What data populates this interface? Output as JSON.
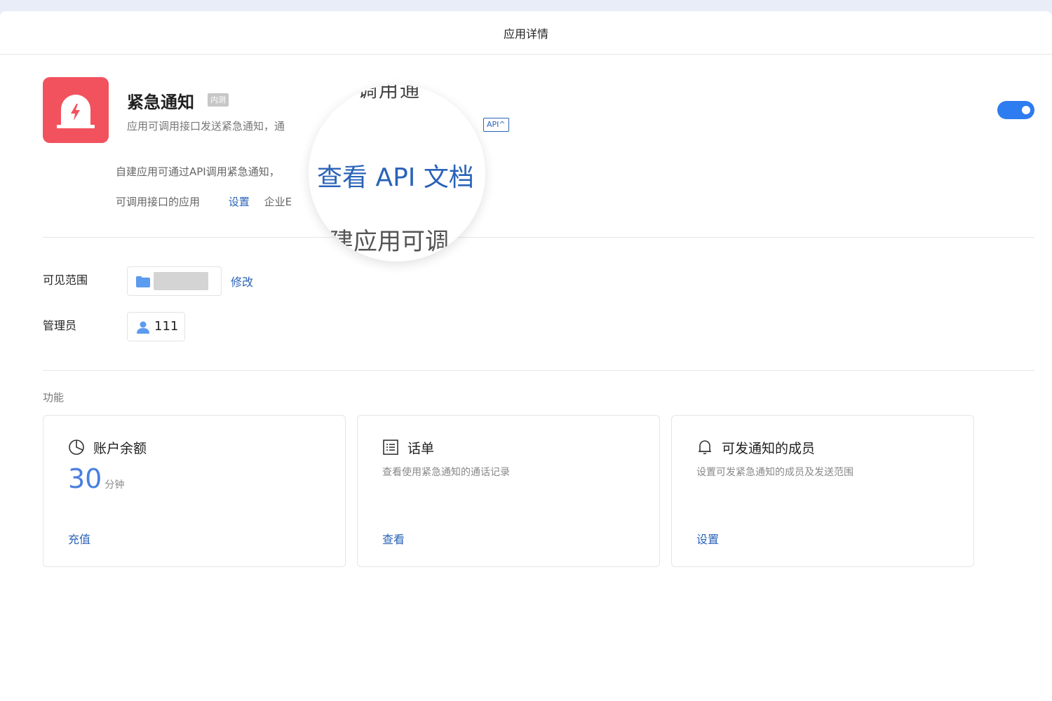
{
  "window": {
    "title": "应用详情"
  },
  "app": {
    "name": "紧急通知",
    "tag": "内测",
    "description": "应用可调用接口发送紧急通知，通",
    "api_badge": "API^",
    "enabled": true
  },
  "info": {
    "line1": "自建应用可通过API调用紧急通知，",
    "callable_label": "可调用接口的应用",
    "settings_link": "设置",
    "enterprise_text": "企业E"
  },
  "magnifier": {
    "top_text": "调用通",
    "link_text": "查看 API 文档",
    "bottom_text": "建应用可调"
  },
  "visibility": {
    "label": "可见范围",
    "modify_link": "修改"
  },
  "admin": {
    "label": "管理员",
    "value": "111"
  },
  "features": {
    "title": "功能",
    "cards": [
      {
        "icon": "pie-chart-icon",
        "title": "账户余额",
        "balance_value": "30",
        "balance_unit": "分钟",
        "action": "充值"
      },
      {
        "icon": "list-icon",
        "title": "话单",
        "description": "查看使用紧急通知的通话记录",
        "action": "查看"
      },
      {
        "icon": "bell-icon",
        "title": "可发通知的成员",
        "description": "设置可发紧急通知的成员及发送范围",
        "action": "设置"
      }
    ]
  },
  "colors": {
    "accent": "#2a63b8",
    "toggle": "#2d7cf0",
    "app_icon_bg": "#f2525e"
  }
}
